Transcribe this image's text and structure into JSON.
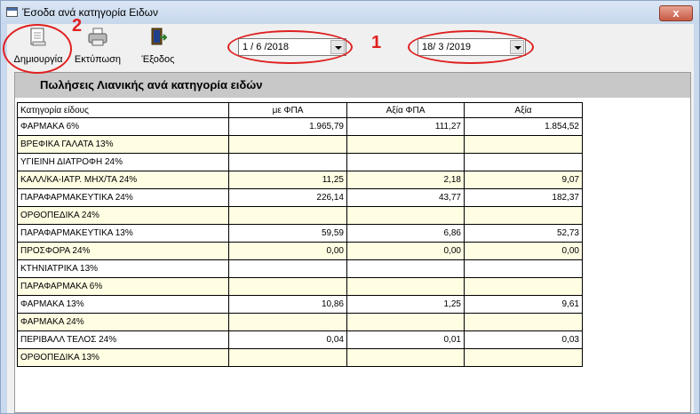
{
  "window": {
    "title": "Έσοδα ανά κατηγορία Ειδων",
    "close_glyph": "x"
  },
  "toolbar": {
    "create_label": "Δημιουργία",
    "print_label": "Εκτύπωση",
    "exit_label": "Έξοδος"
  },
  "filters": {
    "date_from": "1 / 6 /2018",
    "date_to": "18/ 3 /2019"
  },
  "annotations": {
    "num1": "1",
    "num2": "2",
    "color": "#e02020"
  },
  "report": {
    "title": "Πωλήσεις Λιανικής ανά κατηγορία ειδών",
    "columns": [
      "Κατηγορία είδους",
      "με ΦΠΑ",
      "Αξία ΦΠΑ",
      "Αξία"
    ],
    "rows": [
      [
        "ΦΑΡΜΑΚΑ 6%",
        "1.965,79",
        "111,27",
        "1.854,52"
      ],
      [
        "ΒΡΕΦΙΚΑ ΓΑΛΑΤΑ 13%",
        "",
        "",
        ""
      ],
      [
        "ΥΓΙΕΙΝΗ ΔΙΑΤΡΟΦΗ 24%",
        "",
        "",
        ""
      ],
      [
        "ΚΑΛΛ/ΚΑ-ΙΑΤΡ. ΜΗΧ/ΤΑ 24%",
        "11,25",
        "2,18",
        "9,07"
      ],
      [
        "ΠΑΡΑΦΑΡΜΑΚΕΥΤΙΚΑ 24%",
        "226,14",
        "43,77",
        "182,37"
      ],
      [
        "ΟΡΘΟΠΕΔΙΚΑ 24%",
        "",
        "",
        ""
      ],
      [
        "ΠΑΡΑΦΑΡΜΑΚΕΥΤΙΚΑ 13%",
        "59,59",
        "6,86",
        "52,73"
      ],
      [
        "ΠΡΟΣΦΟΡΑ 24%",
        "0,00",
        "0,00",
        "0,00"
      ],
      [
        "ΚΤΗΝΙΑΤΡΙΚΑ 13%",
        "",
        "",
        ""
      ],
      [
        "ΠΑΡΑΦΑΡΜΑΚΑ 6%",
        "",
        "",
        ""
      ],
      [
        "ΦΑΡΜΑΚΑ 13%",
        "10,86",
        "1,25",
        "9,61"
      ],
      [
        "ΦΑΡΜΑΚΑ 24%",
        "",
        "",
        ""
      ],
      [
        "ΠΕΡΙΒΑΛΛ ΤΕΛΟΣ 24%",
        "0,04",
        "0,01",
        "0,03"
      ],
      [
        "ΟΡΘΟΠΕΔΙΚΑ 13%",
        "",
        "",
        ""
      ]
    ]
  }
}
